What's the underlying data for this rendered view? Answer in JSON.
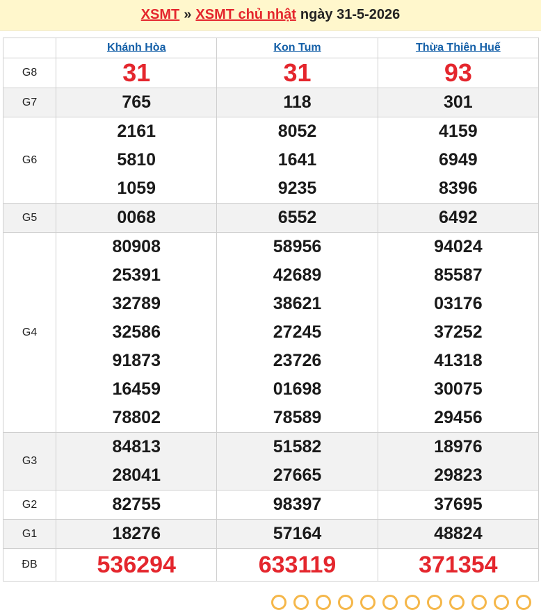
{
  "header": {
    "link1": "XSMT",
    "separator": "»",
    "link2": "XSMT chủ nhật",
    "date_text": "ngày 31-5-2026"
  },
  "provinces": [
    "Khánh Hòa",
    "Kon Tum",
    "Thừa Thiên Huế"
  ],
  "prizes": [
    {
      "label": "G8",
      "style": "big-red",
      "values": [
        [
          "31"
        ],
        [
          "31"
        ],
        [
          "93"
        ]
      ]
    },
    {
      "label": "G7",
      "style": "normal",
      "values": [
        [
          "765"
        ],
        [
          "118"
        ],
        [
          "301"
        ]
      ]
    },
    {
      "label": "G6",
      "style": "normal",
      "values": [
        [
          "2161",
          "5810",
          "1059"
        ],
        [
          "8052",
          "1641",
          "9235"
        ],
        [
          "4159",
          "6949",
          "8396"
        ]
      ]
    },
    {
      "label": "G5",
      "style": "normal",
      "values": [
        [
          "0068"
        ],
        [
          "6552"
        ],
        [
          "6492"
        ]
      ]
    },
    {
      "label": "G4",
      "style": "normal",
      "values": [
        [
          "80908",
          "25391",
          "32789",
          "32586",
          "91873",
          "16459",
          "78802"
        ],
        [
          "58956",
          "42689",
          "38621",
          "27245",
          "23726",
          "01698",
          "78589"
        ],
        [
          "94024",
          "85587",
          "03176",
          "37252",
          "41318",
          "30075",
          "29456"
        ]
      ]
    },
    {
      "label": "G3",
      "style": "normal",
      "values": [
        [
          "84813",
          "28041"
        ],
        [
          "51582",
          "27665"
        ],
        [
          "18976",
          "29823"
        ]
      ]
    },
    {
      "label": "G2",
      "style": "normal",
      "values": [
        [
          "82755"
        ],
        [
          "98397"
        ],
        [
          "37695"
        ]
      ]
    },
    {
      "label": "G1",
      "style": "normal",
      "values": [
        [
          "18276"
        ],
        [
          "57164"
        ],
        [
          "48824"
        ]
      ]
    },
    {
      "label": "ĐB",
      "style": "db-red",
      "values": [
        [
          "536294"
        ],
        [
          "633119"
        ],
        [
          "371354"
        ]
      ]
    }
  ]
}
